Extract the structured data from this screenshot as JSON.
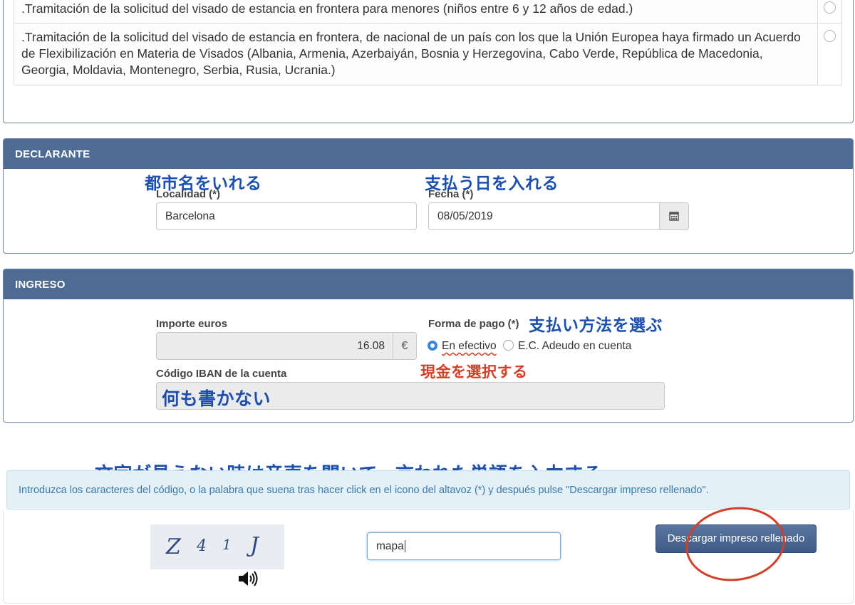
{
  "visa_options": [
    {
      "text": ".Tramitación de la solicitud del visado de estancia en frontera para menores (niños entre 6 y 12 años de edad.)"
    },
    {
      "text": ".Tramitación de la solicitud del visado de estancia en frontera, de nacional de un país con los que la Unión Europea haya firmado un Acuerdo de Flexibilización en Materia de Visados (Albania, Armenia, Azerbaiyán, Bosnia y Herzegovina, Cabo Verde, República de Macedonia, Georgia, Moldavia, Montenegro, Serbia, Rusia, Ucrania.)"
    }
  ],
  "declarante": {
    "title": "DECLARANTE",
    "localidad_label": "Localidad (*)",
    "localidad_value": "Barcelona",
    "fecha_label": "Fecha (*)",
    "fecha_value": "08/05/2019",
    "calendar_icon": "calendar-icon",
    "note_localidad": "都市名をいれる",
    "note_fecha": "支払う日を入れる"
  },
  "ingreso": {
    "title": "INGRESO",
    "importe_label": "Importe euros",
    "importe_value": "16.08",
    "currency": "€",
    "forma_label": "Forma de pago (*)",
    "option_efectivo": "En efectivo",
    "option_adeudo": "E.C. Adeudo en cuenta",
    "selected": "En efectivo",
    "iban_label": "Código IBAN de la cuenta",
    "iban_value": "",
    "note_forma": "支払い方法を選ぶ",
    "note_efectivo": "現金を選択する",
    "note_iban": "何も書かない"
  },
  "captcha": {
    "note": "文字が見えない時は音声を聞いて、言われた単語を入力する",
    "instructions": "Introduzca los caracteres del código, o la palabra que suena tras hacer click en el icono del altavoz (*) y después pulse \"Descargar impreso rellenado\".",
    "chars": [
      "Z",
      "4",
      "1",
      "J"
    ],
    "input_value": "mapa",
    "speaker_icon": "speaker-icon",
    "submit_label": "Descargar impreso rellenado"
  },
  "colors": {
    "panel_header": "#4e6b94",
    "note_blue": "#1c4fae",
    "note_red": "#d2402a",
    "info_bg": "#e3f0f7",
    "button": "#4a6892"
  }
}
